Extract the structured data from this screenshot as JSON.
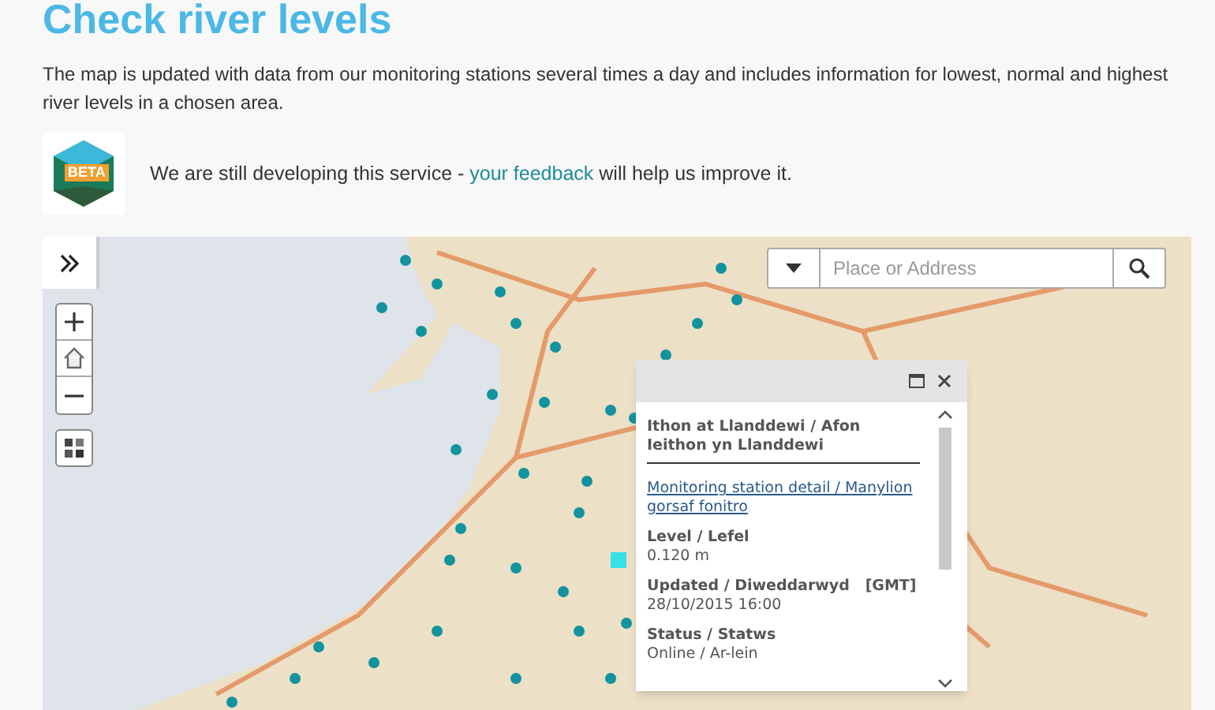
{
  "title": "Check river levels",
  "intro": "The map is updated with data from our monitoring stations several times a day and includes information for lowest, normal and highest river levels in a chosen area.",
  "beta": {
    "badge": "BETA",
    "text_before": "We are still developing this service - ",
    "link": "your feedback",
    "text_after": " will help us improve it."
  },
  "map": {
    "search": {
      "placeholder": "Place or Address"
    },
    "popup": {
      "title": "Ithon at Llanddewi / Afon Ieithon yn Llanddewi",
      "link": "Monitoring station detail / Manylion gorsaf fonitro",
      "fields": [
        {
          "label": "Level / Lefel",
          "value": "0.120 m"
        },
        {
          "label": "Updated / Diweddarwyd   [GMT]",
          "value": "28/10/2015 16:00"
        },
        {
          "label": "Status / Statws",
          "value": "Online / Ar-lein"
        }
      ]
    }
  }
}
